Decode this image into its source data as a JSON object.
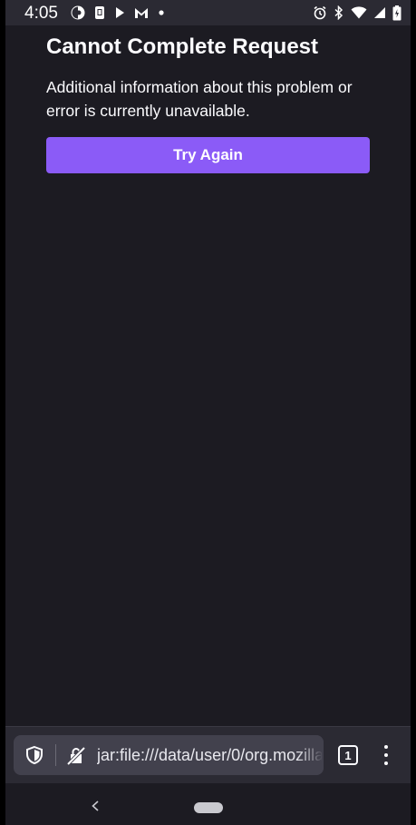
{
  "status_bar": {
    "time": "4:05",
    "left_icons": [
      "firefox-focus-icon",
      "sim-icon",
      "play-icon",
      "gmail-icon",
      "dot-icon"
    ],
    "right_icons": [
      "alarm-icon",
      "bluetooth-icon",
      "wifi-icon",
      "signal-icon",
      "battery-icon"
    ]
  },
  "error": {
    "title": "Cannot Complete Request",
    "description": "Additional information about this problem or error is currently unavailable.",
    "button_label": "Try Again"
  },
  "toolbar": {
    "url": "jar:file:///data/user/0/org.mozilla",
    "tab_count": "1"
  },
  "colors": {
    "background": "#1c1b22",
    "toolbar": "#2b2a33",
    "url_bar": "#42414d",
    "accent": "#8b5bf7"
  }
}
